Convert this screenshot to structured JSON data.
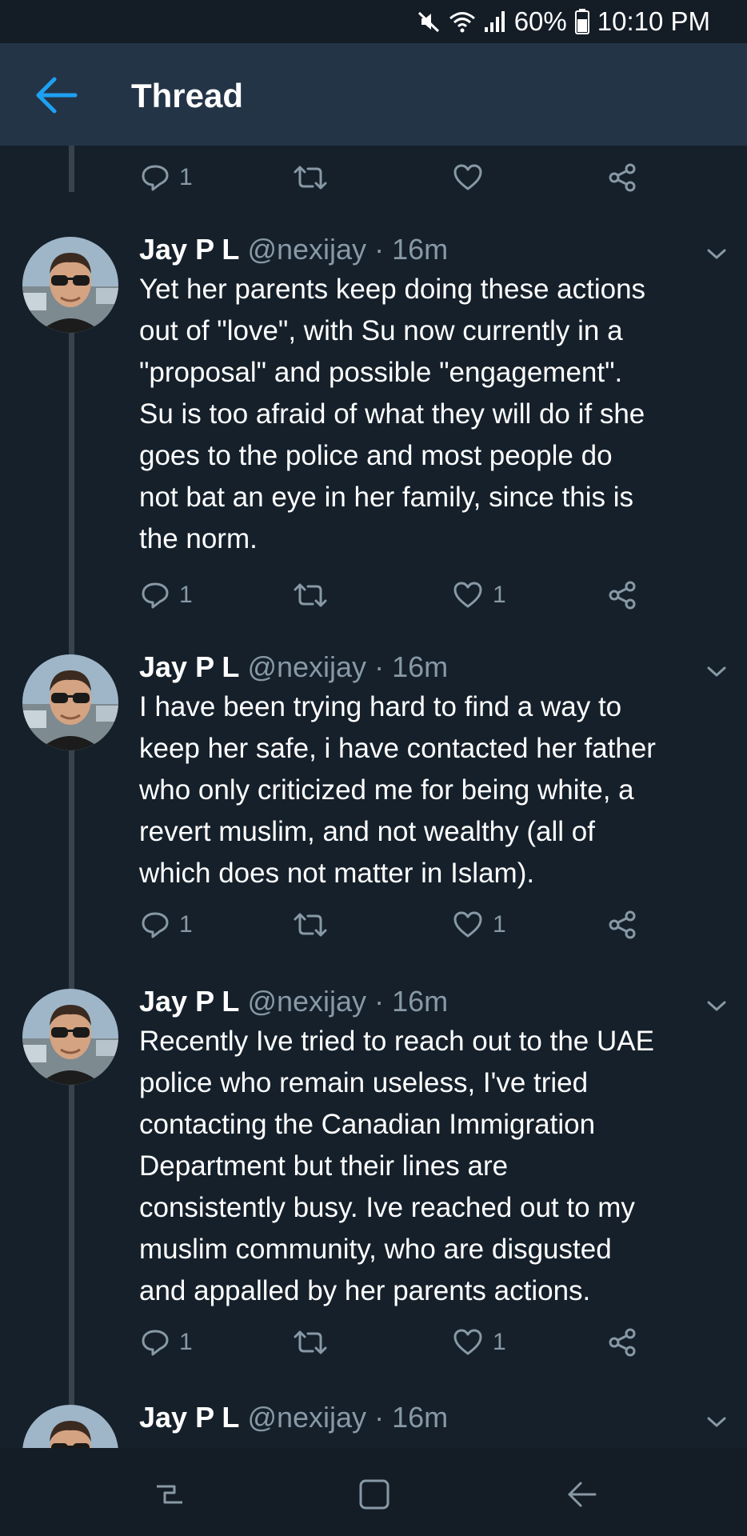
{
  "status_bar": {
    "battery": "60%",
    "time": "10:10 PM",
    "icons": [
      "mute-icon",
      "wifi-icon",
      "signal-icon",
      "battery-icon"
    ]
  },
  "header": {
    "title": "Thread",
    "back_icon": "arrow-left-icon"
  },
  "colors": {
    "background": "#15202b",
    "header_bg": "#243447",
    "accent": "#1da1f2",
    "muted": "#8899a6",
    "thread_line": "#38444d"
  },
  "top_actions": {
    "reply_count": "1",
    "retweet_count": "",
    "like_count": ""
  },
  "tweets": [
    {
      "name": "Jay P L",
      "handle": "@nexijay",
      "separator": "·",
      "time": "16m",
      "text": "Yet her parents keep doing these actions\nout of \"love\", with Su now currently in a\n\"proposal\" and possible \"engagement\".\nSu is too afraid of what they will do if she\ngoes to the police and most people do\nnot bat an eye in her family, since this is\nthe norm.",
      "reply_count": "1",
      "retweet_count": "",
      "like_count": "1"
    },
    {
      "name": "Jay P L",
      "handle": "@nexijay",
      "separator": "·",
      "time": "16m",
      "text": "I have been trying hard to find a way to\nkeep her safe, i have contacted her father\nwho only criticized me for being white, a\nrevert muslim, and not wealthy (all of\nwhich does not matter in Islam).",
      "reply_count": "1",
      "retweet_count": "",
      "like_count": "1"
    },
    {
      "name": "Jay P L",
      "handle": "@nexijay",
      "separator": "·",
      "time": "16m",
      "text": "Recently Ive tried to reach out to the UAE\npolice who remain useless, I've tried\ncontacting the Canadian Immigration\nDepartment but their lines are\nconsistently busy. Ive reached out to my\nmuslim community, who are disgusted\nand appalled by her parents actions.",
      "reply_count": "1",
      "retweet_count": "",
      "like_count": "1"
    },
    {
      "name": "Jay P L",
      "handle": "@nexijay",
      "separator": "·",
      "time": "16m",
      "text": "",
      "reply_count": "",
      "retweet_count": "",
      "like_count": ""
    }
  ],
  "nav_bar": {
    "icons": [
      "recent-apps-icon",
      "home-icon",
      "back-icon"
    ]
  }
}
